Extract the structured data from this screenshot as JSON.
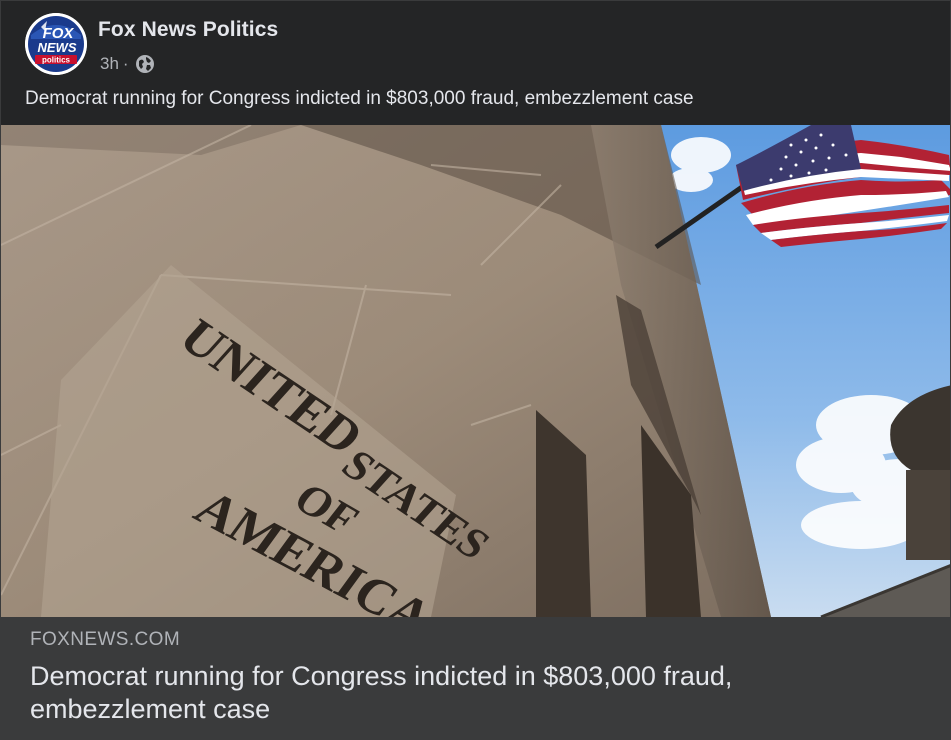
{
  "post": {
    "page_name": "Fox News Politics",
    "timestamp": "3h",
    "separator": "·",
    "privacy_icon": "globe-icon",
    "caption": "Democrat running for Congress indicted in $803,000 fraud, embezzlement case"
  },
  "avatar": {
    "logo_line1": "FOX",
    "logo_line2": "NEWS",
    "logo_line3": "politics"
  },
  "photo": {
    "engraving_line1": "UNITED",
    "engraving_line2": "STATES",
    "engraving_line3": "OF",
    "engraving_line4": "AMERICA"
  },
  "link_preview": {
    "domain": "FOXNEWS.COM",
    "title": "Democrat running for Congress indicted in $803,000 fraud, embezzlement case"
  },
  "colors": {
    "card_bg": "#242526",
    "link_box_bg": "#3a3b3c",
    "primary_text": "#e4e6eb",
    "secondary_text": "#b0b3b8",
    "fox_blue": "#1a3a8c",
    "fox_red": "#c8102e"
  }
}
